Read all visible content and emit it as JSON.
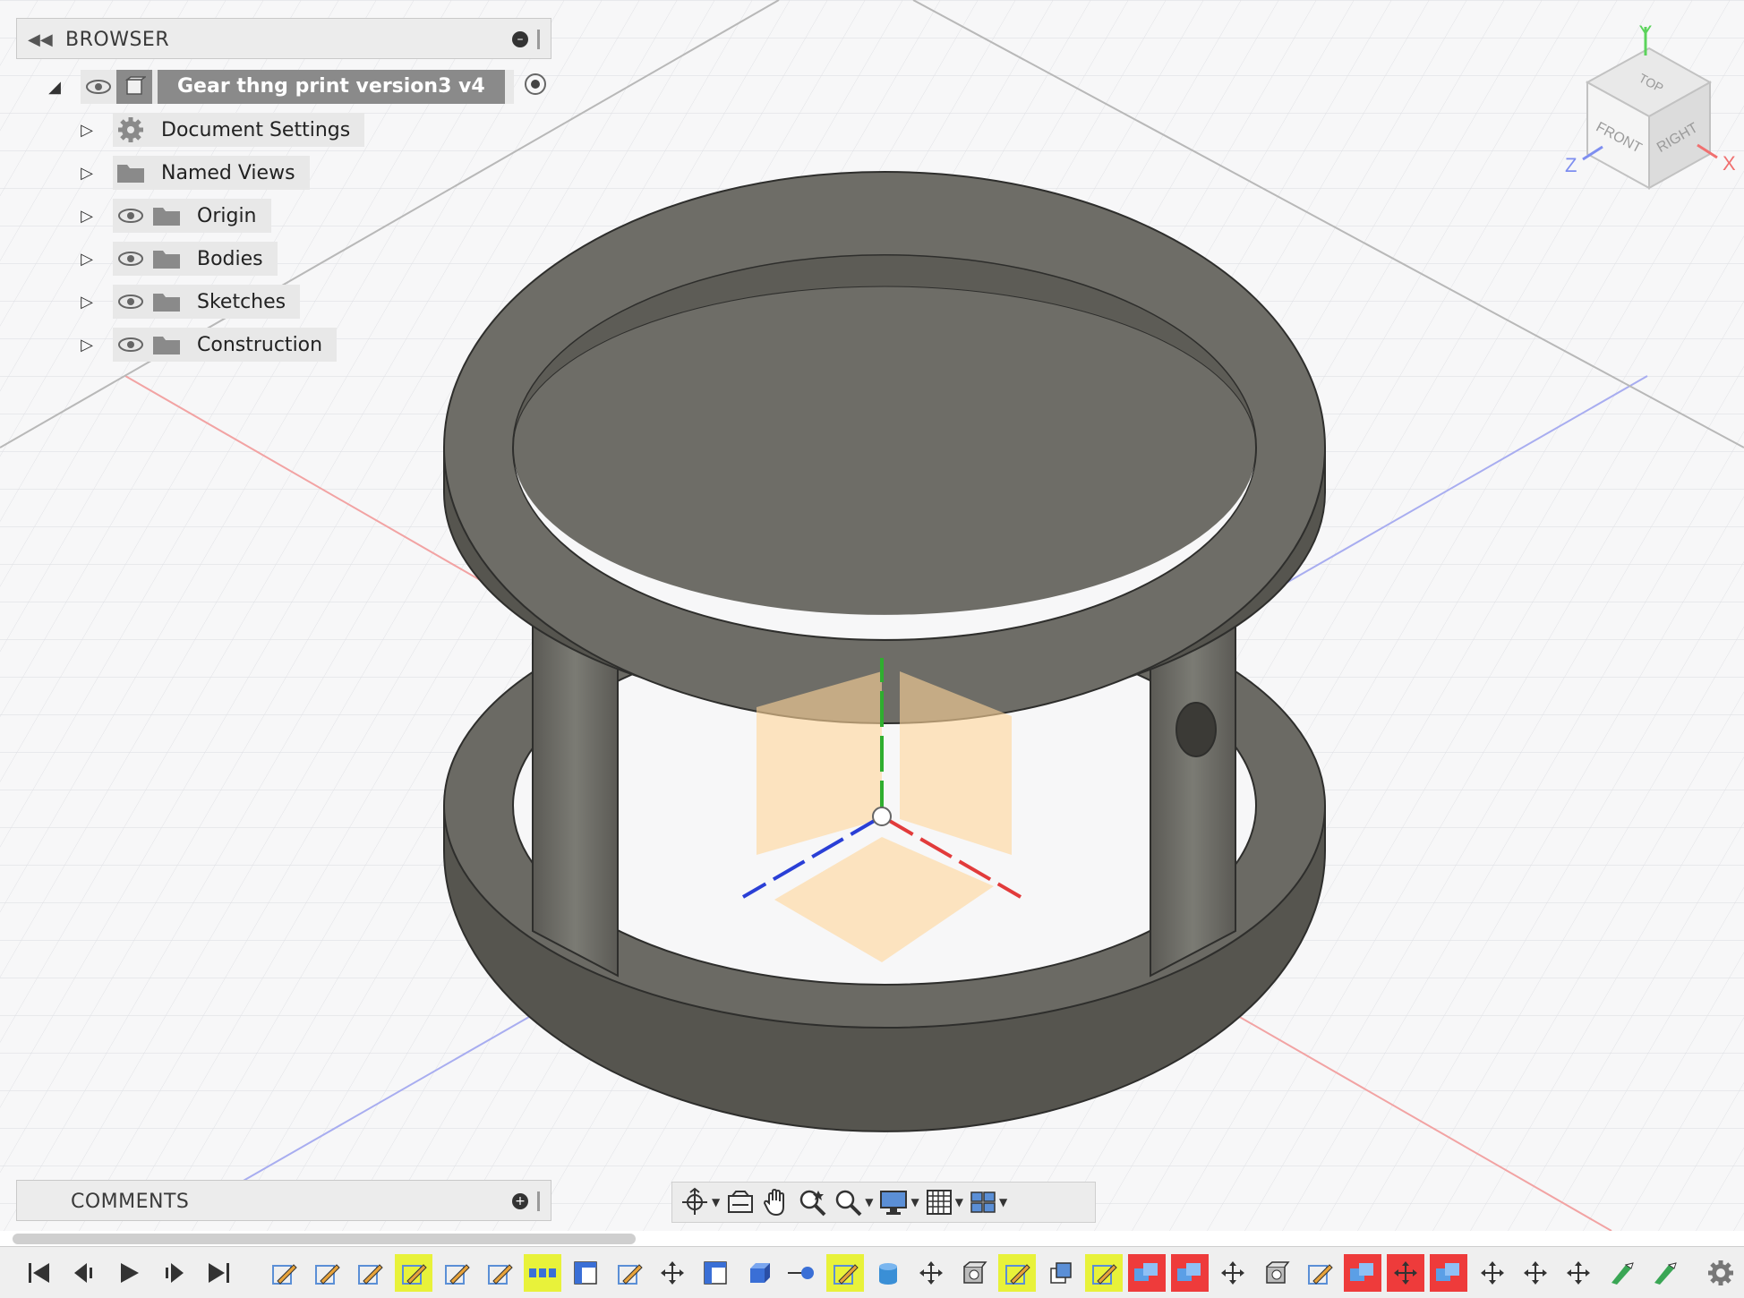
{
  "browser": {
    "title": "BROWSER",
    "root": {
      "label": "Gear thng print version3 v4"
    },
    "items": [
      {
        "label": "Document Settings",
        "icon": "gear-icon",
        "visibility": false
      },
      {
        "label": "Named Views",
        "icon": "folder-icon",
        "visibility": false
      },
      {
        "label": "Origin",
        "icon": "folder-icon",
        "visibility": true
      },
      {
        "label": "Bodies",
        "icon": "folder-icon",
        "visibility": true
      },
      {
        "label": "Sketches",
        "icon": "folder-icon",
        "visibility": true
      },
      {
        "label": "Construction",
        "icon": "folder-icon",
        "visibility": true
      }
    ]
  },
  "comments": {
    "title": "COMMENTS"
  },
  "viewcube": {
    "top": "TOP",
    "front": "FRONT",
    "right": "RIGHT",
    "axis_x": "X",
    "axis_y": "Y",
    "axis_z": "Z"
  },
  "navigation": [
    "orbit-icon",
    "look-at-icon",
    "pan-icon",
    "zoom-icon",
    "zoom-window-icon",
    "display-settings-icon",
    "grid-settings-icon",
    "viewports-icon"
  ],
  "timeline": {
    "controls": [
      "first-icon",
      "previous-icon",
      "play-icon",
      "next-icon",
      "last-icon"
    ],
    "features": [
      "sketch",
      "sketch",
      "sketch",
      "sketch-active",
      "sketch",
      "sketch",
      "pattern",
      "sketch-plane",
      "sketch",
      "move",
      "sketch-plane",
      "box",
      "point",
      "sketch-active",
      "cylinder",
      "move",
      "shell",
      "sketch-active",
      "plane",
      "sketch-active",
      "combine-error",
      "combine-error",
      "move",
      "shell",
      "sketch",
      "combine-error",
      "move-error",
      "combine-error",
      "move",
      "move",
      "move",
      "fillet",
      "fillet"
    ]
  },
  "colors": {
    "accent_yellow": "#e8f23a",
    "error_red": "#ee3b3b",
    "body_gray": "#6a6a66",
    "axis_red": "#e23b3b",
    "axis_blue": "#2a3fd6",
    "axis_green": "#2fae2f",
    "origin_orange": "#ffd59a"
  }
}
